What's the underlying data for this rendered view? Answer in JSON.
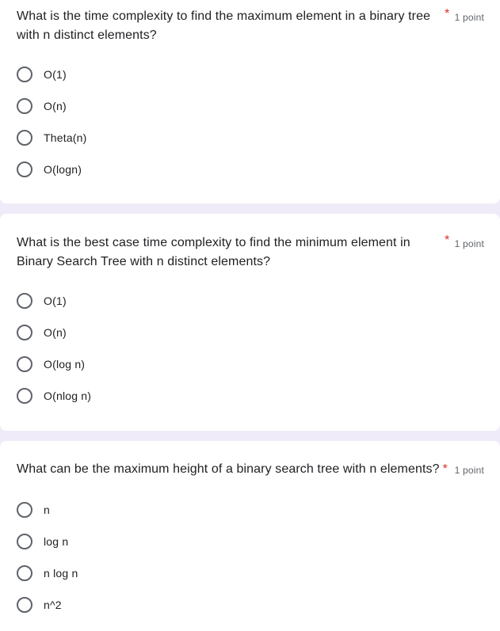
{
  "questions": [
    {
      "text": "What is the time complexity to find the maximum element in a binary tree with n distinct elements?",
      "line1": "What is the time complexity to find the maximum element in a binary tree",
      "line2": "with n distinct elements?",
      "required_mark": "*",
      "points": "1 point",
      "options": [
        "O(1)",
        "O(n)",
        "Theta(n)",
        "O(logn)"
      ]
    },
    {
      "text": "What is the best case time complexity to find the minimum element in Binary Search Tree with n distinct elements?",
      "line1": "What is the best case time complexity to find the minimum element in",
      "line2": "Binary Search Tree with n distinct elements?",
      "required_mark": "*",
      "points": "1 point",
      "options": [
        "O(1)",
        "O(n)",
        "O(log n)",
        "O(nlog n)"
      ]
    },
    {
      "text": "What can be the maximum height of a binary search tree with n elements?",
      "line1": "What can be the maximum height of a binary search tree with n elements?",
      "required_mark": "*",
      "points": "1 point",
      "options": [
        "n",
        "log n",
        "n log n",
        "n^2"
      ]
    }
  ]
}
